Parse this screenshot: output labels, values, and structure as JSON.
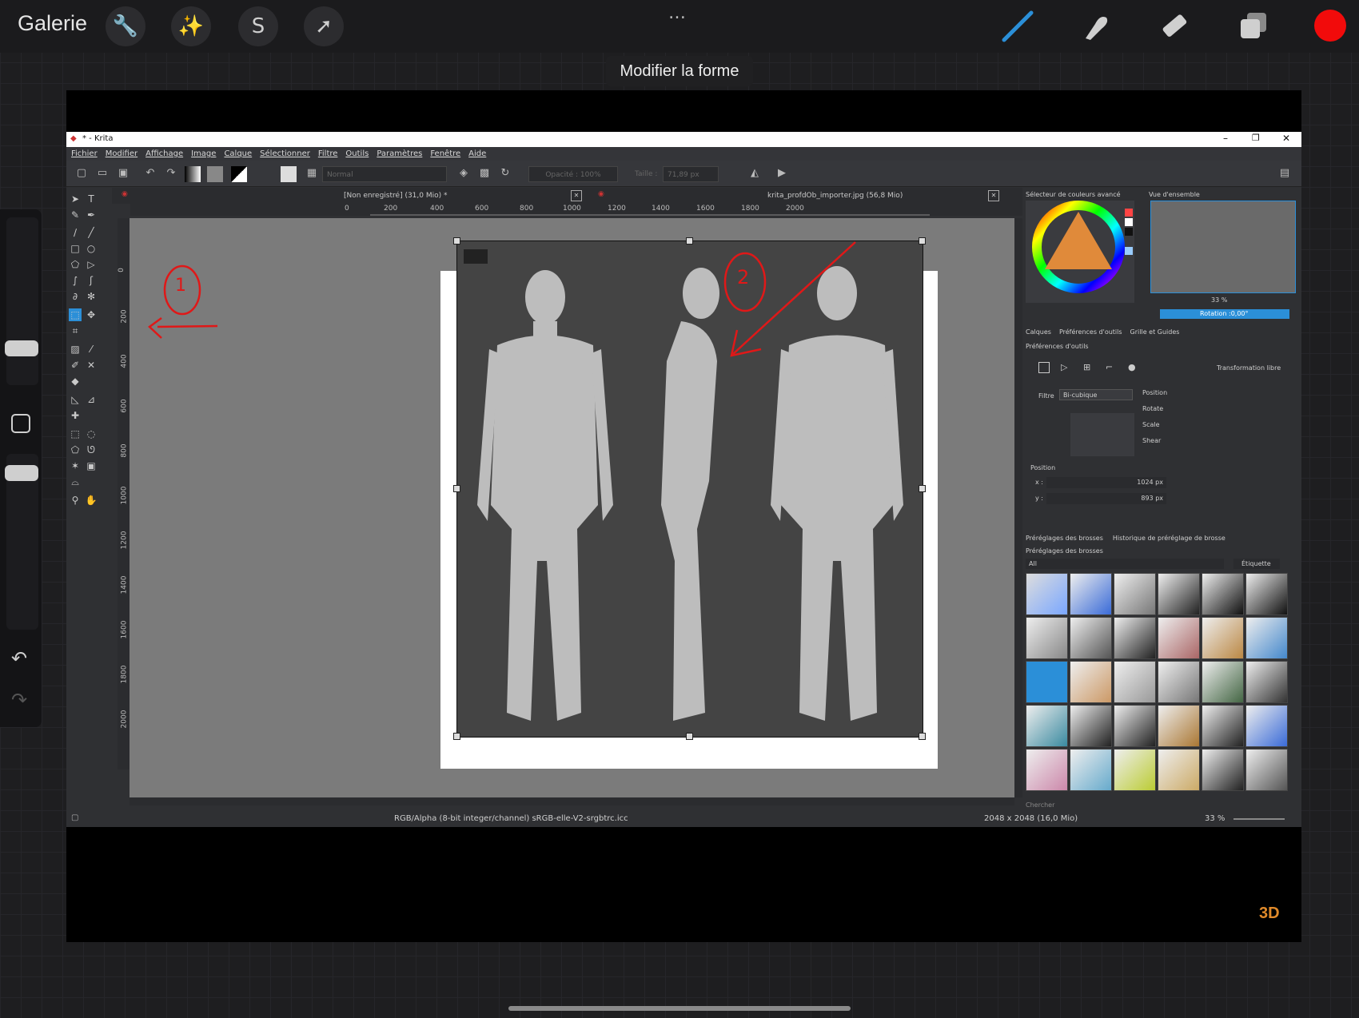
{
  "procreate": {
    "gallery": "Galerie",
    "tooltip": "Modifier la forme",
    "more_icon": "…",
    "current_color": "#f20b0b"
  },
  "krita": {
    "window_title": "* - Krita",
    "menu": [
      "Fichier",
      "Modifier",
      "Affichage",
      "Image",
      "Calque",
      "Sélectionner",
      "Filtre",
      "Outils",
      "Paramètres",
      "Fenêtre",
      "Aide"
    ],
    "blend_mode": "Normal",
    "opacity": "Opacité : 100%",
    "size": "Taille :",
    "size_value": "71,89 px",
    "tabs": [
      "[Non enregistré]  (31,0 Mio) *",
      "krita_profdOb_importer.jpg (56,8 Mio)"
    ],
    "ruler_top": [
      "0",
      "200",
      "400",
      "600",
      "800",
      "1000",
      "1200",
      "1400",
      "1600",
      "1800",
      "2000"
    ],
    "ruler_left": [
      "0",
      "200",
      "400",
      "600",
      "800",
      "1000",
      "1200",
      "1400",
      "1600",
      "1800",
      "2000"
    ],
    "annotations": [
      "1",
      "2"
    ],
    "dock": {
      "color_selector": "Sélecteur de couleurs avancé",
      "overview": "Vue d'ensemble",
      "zoom": "33 %",
      "rotation": "Rotation :0,00°",
      "tabs": [
        "Calques",
        "Préférences d'outils",
        "Grille et Guides"
      ],
      "tool_options_title": "Préférences d'outils",
      "transform_label": "Transformation libre",
      "filter_label": "Filtre",
      "filter_value": "Bi-cubique",
      "radio": [
        "Position",
        "Rotate",
        "Scale",
        "Shear"
      ],
      "position_label": "Position",
      "x_label": "x :",
      "x_value": "1024 px",
      "y_label": "y :",
      "y_value": "893 px",
      "brush_tabs": [
        "Préréglages des brosses",
        "Historique de préréglage de brosse"
      ],
      "brush_title": "Préréglages des brosses",
      "brush_filter": "All",
      "tag_label": "Étiquette",
      "search_placeholder": "Chercher"
    },
    "status": {
      "colorspace": "RGB/Alpha (8-bit integer/channel)  sRGB-elle-V2-srgbtrc.icc",
      "dimensions": "2048 x 2048 (16,0 Mio)",
      "zoom": "33 %"
    }
  },
  "colors": {
    "accent_blue": "#2b8fd8",
    "annotation_red": "#e01818"
  },
  "watermark": "3D"
}
